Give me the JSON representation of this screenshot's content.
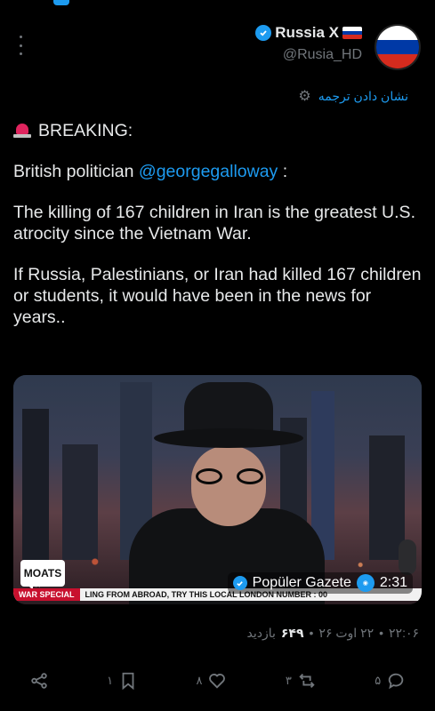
{
  "author": {
    "name": "Russia X",
    "handle": "@Rusia_HD"
  },
  "translate_label": "نشان دادن ترجمه",
  "post": {
    "breaking": "BREAKING:",
    "intro_text": "British politician",
    "mention": "@georgegalloway",
    "intro_suffix": " :",
    "para2": "The killing of 167 children in Iran is the greatest U.S. atrocity since the Vietnam War.",
    "para3": "If Russia, Palestinians, or Iran had killed 167 children or students, it would have been in the news for years.."
  },
  "media": {
    "logo_text": "MOATS",
    "ticker_tag": "WAR SPECIAL",
    "ticker_text": "LING FROM ABROAD, TRY THIS LOCAL LONDON NUMBER : 00",
    "source": "Popüler Gazete",
    "duration": "2:31"
  },
  "meta": {
    "time": "۲۲:۰۶",
    "date": "۲۲ اوت ۲۶",
    "views": "۶۴۹",
    "views_label": "بازدید"
  },
  "actions": {
    "replies": "۵",
    "reposts": "۳",
    "likes": "۸",
    "bookmarks": "۱"
  },
  "colors": {
    "accent": "#1d9bf0",
    "background": "#000000",
    "muted": "#71767b"
  }
}
